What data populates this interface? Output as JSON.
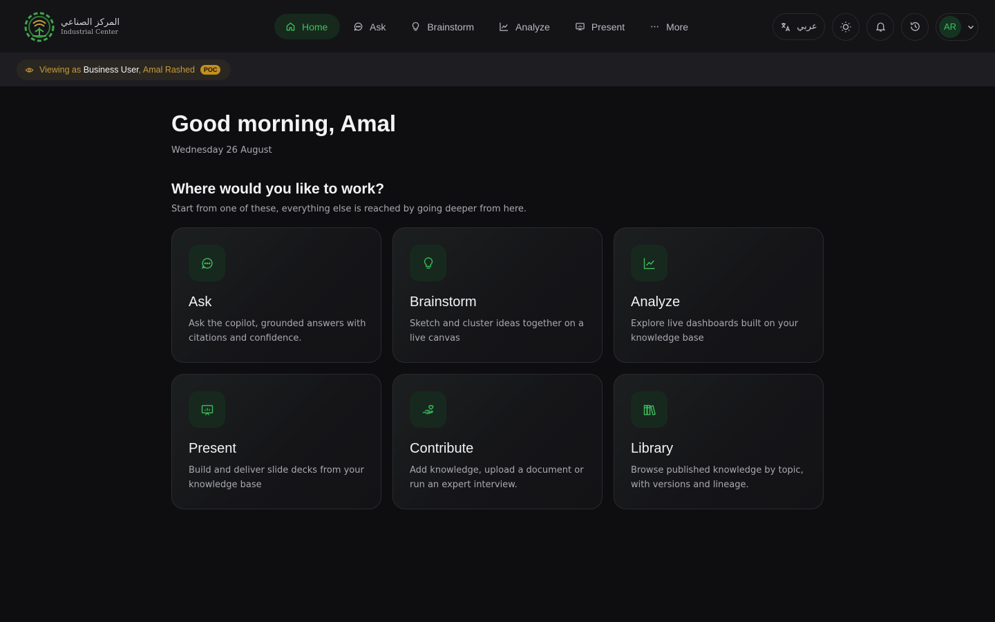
{
  "brand": {
    "name_ar": "المركز الصناعي",
    "name_en": "Industrial Center"
  },
  "nav": {
    "items": [
      {
        "label": "Home",
        "icon": "home-icon",
        "active": true
      },
      {
        "label": "Ask",
        "icon": "chat-bubble-icon",
        "active": false
      },
      {
        "label": "Brainstorm",
        "icon": "lightbulb-icon",
        "active": false
      },
      {
        "label": "Analyze",
        "icon": "chart-line-icon",
        "active": false
      },
      {
        "label": "Present",
        "icon": "presentation-icon",
        "active": false
      },
      {
        "label": "More",
        "icon": "ellipsis-icon",
        "active": false
      }
    ]
  },
  "toolbar": {
    "language_label": "عربي",
    "avatar_initials": "AR"
  },
  "viewing": {
    "prefix": "Viewing as",
    "role": "Business User",
    "name": ", Amal Rashed",
    "badge": "POC"
  },
  "main": {
    "greeting": "Good morning, Amal",
    "date": "Wednesday 26 August",
    "section_title": "Where would you like to work?",
    "section_subtitle": "Start from one of these, everything else is reached by going deeper from here.",
    "cards": [
      {
        "title": "Ask",
        "description": "Ask the copilot, grounded answers with citations and confidence.",
        "icon": "chat-bubble-icon"
      },
      {
        "title": "Brainstorm",
        "description": "Sketch and cluster ideas together on a live canvas",
        "icon": "lightbulb-icon"
      },
      {
        "title": "Analyze",
        "description": "Explore live dashboards built on your knowledge base",
        "icon": "chart-line-icon"
      },
      {
        "title": "Present",
        "description": "Build and deliver slide decks from your knowledge base",
        "icon": "presentation-icon"
      },
      {
        "title": "Contribute",
        "description": "Add knowledge, upload a document or run an expert interview.",
        "icon": "hand-heart-icon"
      },
      {
        "title": "Library",
        "description": "Browse published knowledge by topic, with versions and lineage.",
        "icon": "books-icon"
      }
    ]
  },
  "colors": {
    "accent": "#3fbf5f",
    "background": "#0e0e11",
    "badge": "#c58f1f"
  }
}
